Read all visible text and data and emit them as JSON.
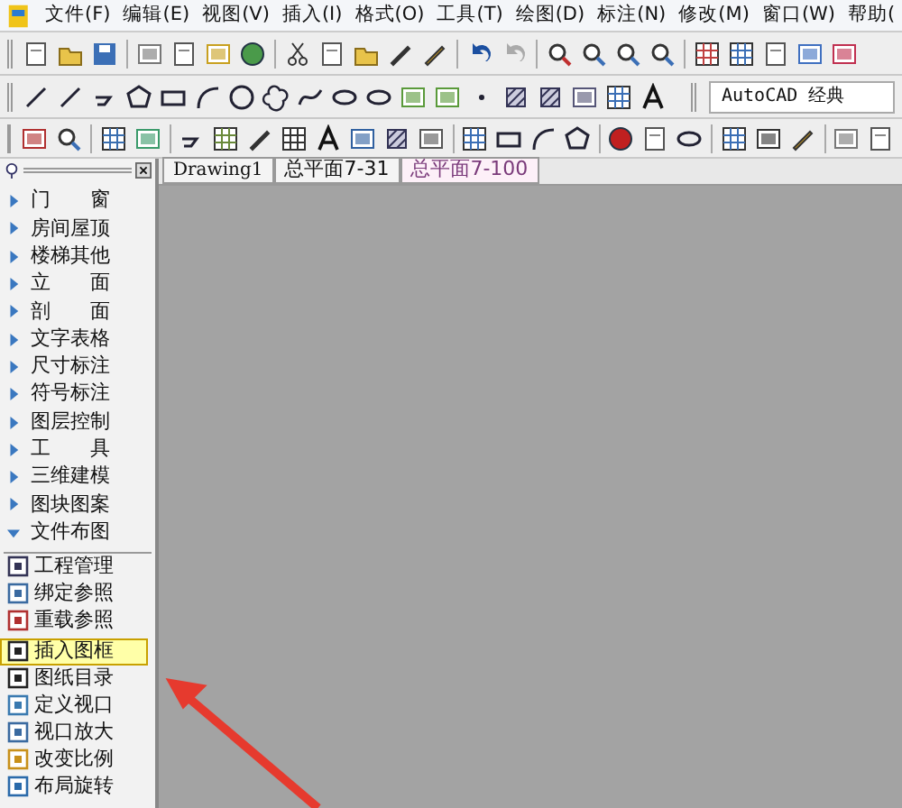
{
  "menu": [
    "文件(F)",
    "编辑(E)",
    "视图(V)",
    "插入(I)",
    "格式(O)",
    "工具(T)",
    "绘图(D)",
    "标注(N)",
    "修改(M)",
    "窗口(W)",
    "帮助("
  ],
  "workspace": {
    "value": "AutoCAD 经典"
  },
  "tabs": [
    {
      "label": "Drawing1",
      "selected": false
    },
    {
      "label": "总平面7-31",
      "selected": false
    },
    {
      "label": "总平面7-100",
      "selected": true
    }
  ],
  "panel": {
    "categories": [
      {
        "label": "门　　窗",
        "expanded": false
      },
      {
        "label": "房间屋顶",
        "expanded": false
      },
      {
        "label": "楼梯其他",
        "expanded": false
      },
      {
        "label": "立　　面",
        "expanded": false
      },
      {
        "label": "剖　　面",
        "expanded": false
      },
      {
        "label": "文字表格",
        "expanded": false
      },
      {
        "label": "尺寸标注",
        "expanded": false
      },
      {
        "label": "符号标注",
        "expanded": false
      },
      {
        "label": "图层控制",
        "expanded": false
      },
      {
        "label": "工　　具",
        "expanded": false
      },
      {
        "label": "三维建模",
        "expanded": false
      },
      {
        "label": "图块图案",
        "expanded": false
      },
      {
        "label": "文件布图",
        "expanded": true
      }
    ],
    "commands": [
      {
        "label": "工程管理",
        "selected": false
      },
      {
        "label": "绑定参照",
        "selected": false
      },
      {
        "label": "重载参照",
        "selected": false
      },
      {
        "label": "插入图框",
        "selected": true
      },
      {
        "label": "图纸目录",
        "selected": false
      },
      {
        "label": "定义视口",
        "selected": false
      },
      {
        "label": "视口放大",
        "selected": false
      },
      {
        "label": "改变比例",
        "selected": false
      },
      {
        "label": "布局旋转",
        "selected": false
      }
    ]
  }
}
